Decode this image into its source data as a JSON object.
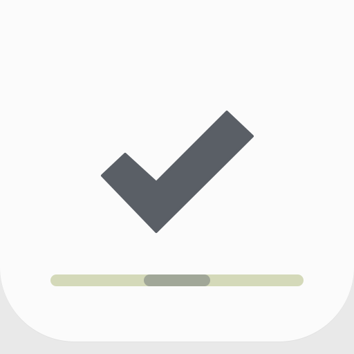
{
  "app_icon": {
    "icon_name": "checkmark-icon",
    "colors": {
      "tile_background": "#fbfbfb",
      "outer_background": "#e9e9e9",
      "checkmark": "#5a5f66",
      "track": "#d4d9b9",
      "thumb": "#a1a798"
    },
    "progress": {
      "start_fraction": 0.37,
      "end_fraction": 0.63
    }
  }
}
